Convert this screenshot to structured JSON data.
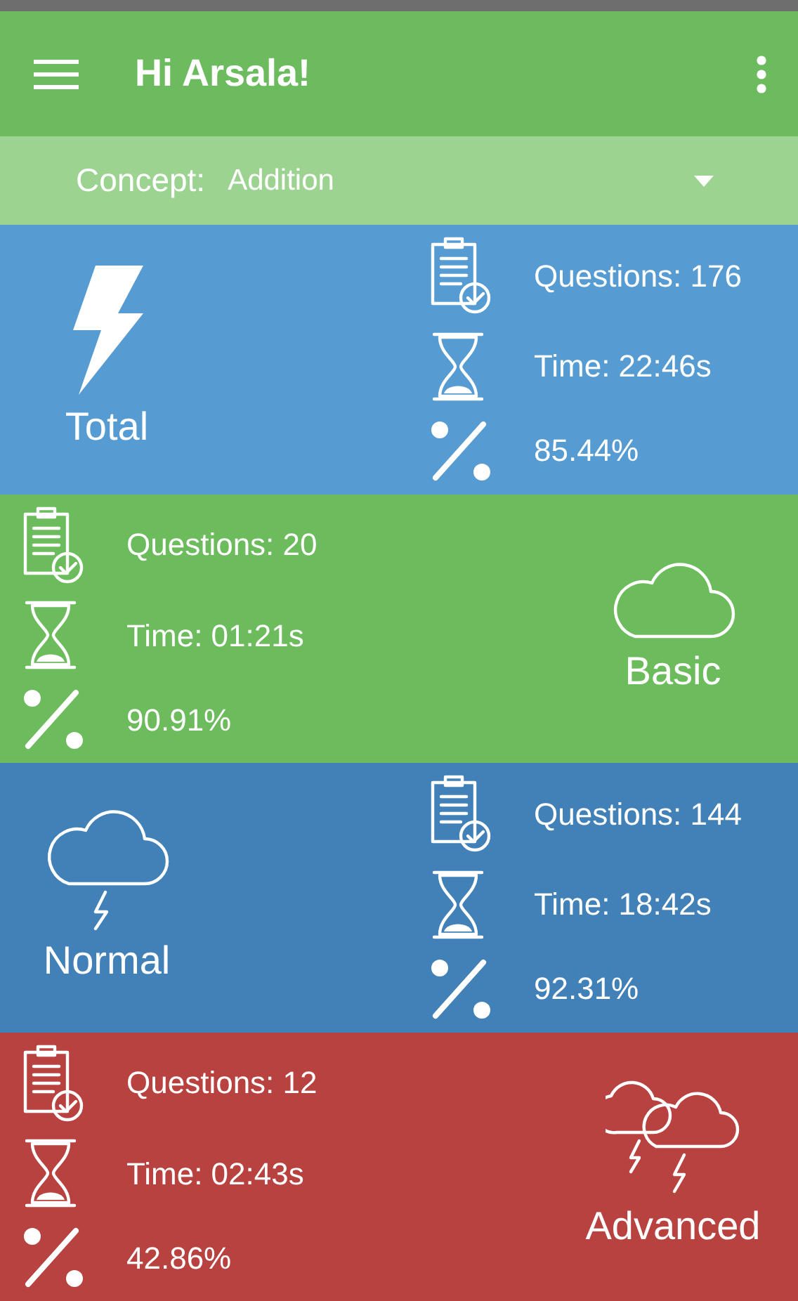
{
  "app_bar": {
    "title": "Hi Arsala!"
  },
  "concept": {
    "label": "Concept:",
    "value": "Addition"
  },
  "panels": [
    {
      "name": "Total",
      "color": "#569cd3",
      "stats": [
        {
          "kind": "questions",
          "text": "Questions: 176"
        },
        {
          "kind": "time",
          "text": "Time: 22:46s"
        },
        {
          "kind": "percent",
          "text": "85.44%"
        }
      ]
    },
    {
      "name": "Basic",
      "color": "#6cbb5c",
      "stats": [
        {
          "kind": "questions",
          "text": "Questions: 20"
        },
        {
          "kind": "time",
          "text": "Time: 01:21s"
        },
        {
          "kind": "percent",
          "text": "90.91%"
        }
      ]
    },
    {
      "name": "Normal",
      "color": "#4181b8",
      "stats": [
        {
          "kind": "questions",
          "text": "Questions: 144"
        },
        {
          "kind": "time",
          "text": "Time: 18:42s"
        },
        {
          "kind": "percent",
          "text": "92.31%"
        }
      ]
    },
    {
      "name": "Advanced",
      "color": "#b8423f",
      "stats": [
        {
          "kind": "questions",
          "text": "Questions: 12"
        },
        {
          "kind": "time",
          "text": "Time: 02:43s"
        },
        {
          "kind": "percent",
          "text": "42.86%"
        }
      ]
    }
  ]
}
